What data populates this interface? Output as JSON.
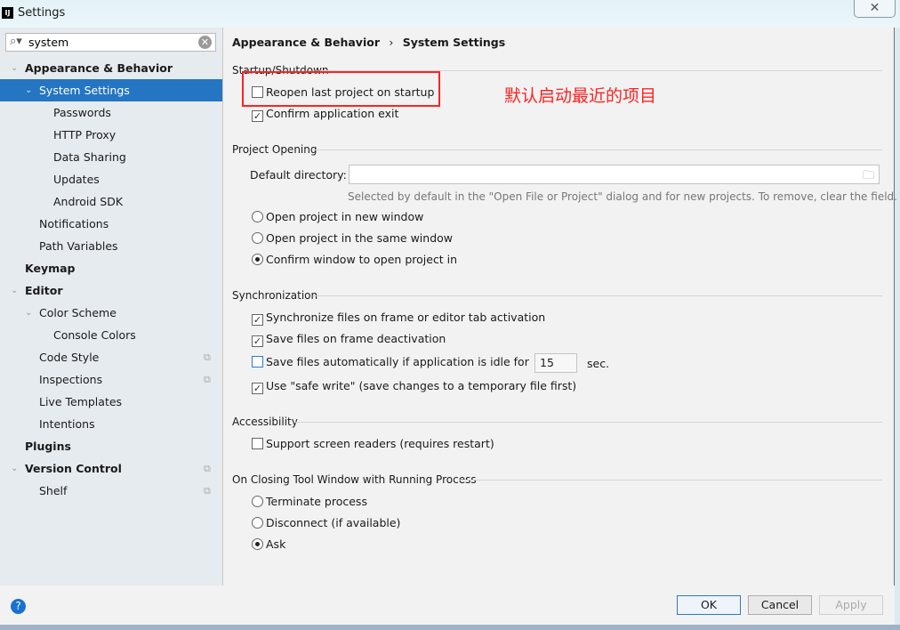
{
  "window": {
    "title": "Settings",
    "logo": "IJ",
    "close_icon": "close-icon"
  },
  "search": {
    "value": "system"
  },
  "tree": [
    {
      "label": "Appearance & Behavior",
      "bold": true,
      "chev": true,
      "indent": 0
    },
    {
      "label": "System Settings",
      "chev": true,
      "indent": 1,
      "selected": true
    },
    {
      "label": "Passwords",
      "indent": 2
    },
    {
      "label": "HTTP Proxy",
      "indent": 2
    },
    {
      "label": "Data Sharing",
      "indent": 2
    },
    {
      "label": "Updates",
      "indent": 2
    },
    {
      "label": "Android SDK",
      "indent": 2
    },
    {
      "label": "Notifications",
      "indent": 1
    },
    {
      "label": "Path Variables",
      "indent": 1
    },
    {
      "label": "Keymap",
      "bold": true,
      "indent": 0
    },
    {
      "label": "Editor",
      "bold": true,
      "chev": true,
      "indent": 0
    },
    {
      "label": "Color Scheme",
      "chev": true,
      "indent": 1
    },
    {
      "label": "Console Colors",
      "indent": 2
    },
    {
      "label": "Code Style",
      "indent": 1,
      "copy": true
    },
    {
      "label": "Inspections",
      "indent": 1,
      "copy": true
    },
    {
      "label": "Live Templates",
      "indent": 1
    },
    {
      "label": "Intentions",
      "indent": 1
    },
    {
      "label": "Plugins",
      "bold": true,
      "indent": 0
    },
    {
      "label": "Version Control",
      "bold": true,
      "chev": true,
      "indent": 0,
      "copy": true
    },
    {
      "label": "Shelf",
      "indent": 1,
      "copy": true
    }
  ],
  "breadcrumb": {
    "parent": "Appearance & Behavior",
    "sep": "›",
    "current": "System Settings"
  },
  "startup": {
    "title": "Startup/Shutdown",
    "reopen": "Reopen last project on startup",
    "reopen_checked": false,
    "confirm_exit": "Confirm application exit",
    "confirm_checked": true
  },
  "annotation": "默认启动最近的项目",
  "project_opening": {
    "title": "Project Opening",
    "dir_label": "Default directory:",
    "dir_value": "",
    "hint": "Selected by default in the \"Open File or Project\" dialog and for new projects. To remove, clear the field.",
    "options": [
      "Open project in new window",
      "Open project in the same window",
      "Confirm window to open project in"
    ],
    "selected": 2
  },
  "sync": {
    "title": "Synchronization",
    "items": [
      "Synchronize files on frame or editor tab activation",
      "Save files on frame deactivation",
      "Save files automatically if application is idle for",
      "Use \"safe write\" (save changes to a temporary file first)"
    ],
    "checked": [
      true,
      true,
      false,
      true
    ],
    "idle_value": "15",
    "idle_unit": "sec."
  },
  "accessibility": {
    "title": "Accessibility",
    "screen_readers": "Support screen readers (requires restart)",
    "checked": false
  },
  "closing": {
    "title": "On Closing Tool Window with Running Process",
    "options": [
      "Terminate process",
      "Disconnect (if available)",
      "Ask"
    ],
    "selected": 2
  },
  "buttons": {
    "ok": "OK",
    "cancel": "Cancel",
    "apply": "Apply",
    "help": "?"
  },
  "colors": {
    "selection": "#2475c2",
    "annotation": "#ff2222"
  }
}
